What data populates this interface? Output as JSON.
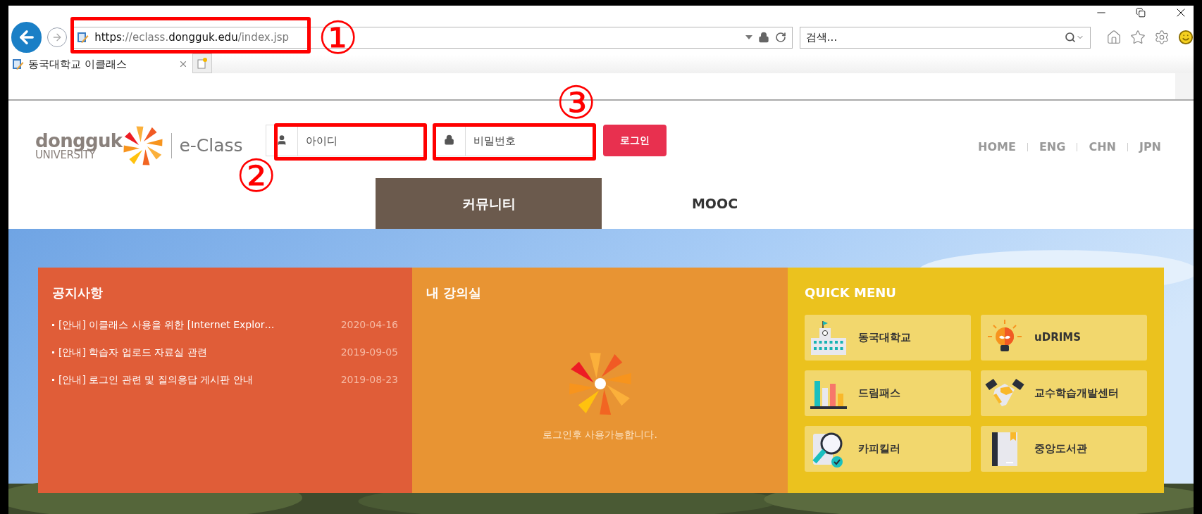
{
  "annotations": [
    {
      "label": "①",
      "kind": "address"
    },
    {
      "label": "②",
      "kind": "id"
    },
    {
      "label": "③",
      "kind": "password"
    }
  ],
  "browser": {
    "address": [
      {
        "text": "https",
        "strong": true
      },
      {
        "text": "://eclass.",
        "strong": false
      },
      {
        "text": "dongguk.edu",
        "strong": true
      },
      {
        "text": "/index.jsp",
        "strong": false
      }
    ],
    "search": {
      "placeholder": "검색..."
    },
    "tabs": [
      {
        "label": "동국대학교 이클래스",
        "selected": true
      }
    ]
  },
  "header": {
    "logo": {
      "name": "dongguk",
      "sub": "UNIVERSITY",
      "product": "e-Class"
    },
    "login": {
      "id_placeholder": "아이디",
      "password_placeholder": "비밀번호",
      "button": "로그인"
    },
    "links": [
      "HOME",
      "ENG",
      "CHN",
      "JPN"
    ]
  },
  "nav": [
    {
      "label": "커뮤니티",
      "selected": true
    },
    {
      "label": "MOOC",
      "selected": false
    }
  ],
  "panels": {
    "notices": {
      "title": "공지사항",
      "items": [
        {
          "title": "[안내] 이클래스 사용을 위한 [Internet Explor…",
          "date": "2020-04-16"
        },
        {
          "title": "[안내] 학습자 업로드 자료실 관련",
          "date": "2019-09-05"
        },
        {
          "title": "[안내] 로그인 관련 및 질의응답 게시판 안내",
          "date": "2019-08-23"
        }
      ]
    },
    "classroom": {
      "title": "내 강의실",
      "message": "로그인후 사용가능합니다."
    },
    "quick_menu": {
      "title": "QUICK MENU",
      "items": [
        {
          "label": "동국대학교",
          "kind": "school"
        },
        {
          "label": "uDRIMS",
          "kind": "bulb"
        },
        {
          "label": "드림패스",
          "kind": "chart"
        },
        {
          "label": "교수학습개발센터",
          "kind": "handshake"
        },
        {
          "label": "카피킬러",
          "kind": "magnifier"
        },
        {
          "label": "중앙도서관",
          "kind": "book"
        }
      ]
    }
  }
}
